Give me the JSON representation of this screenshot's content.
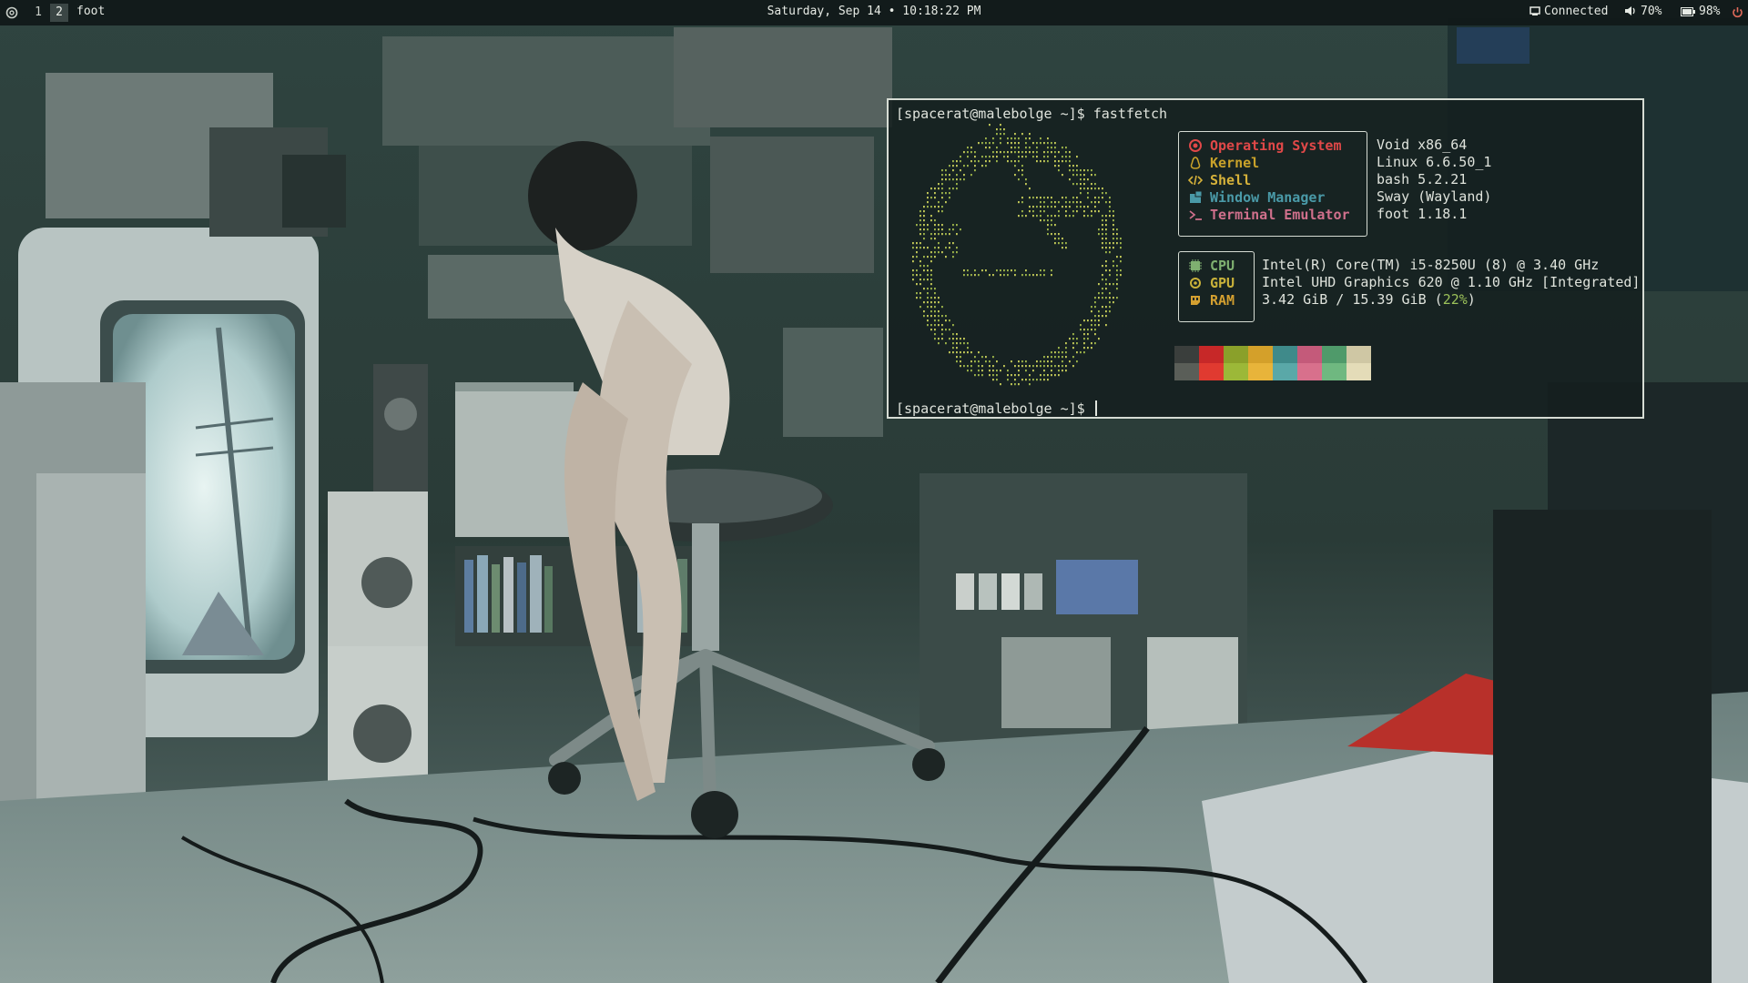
{
  "topbar": {
    "workspaces": [
      "1",
      "2"
    ],
    "active_workspace": "2",
    "app_title": "foot",
    "clock": "Saturday, Sep 14 • 10:18:22 PM",
    "network": "Connected",
    "volume": "70%",
    "battery": "98%",
    "icons": [
      "void-logo-icon",
      "network-icon",
      "volume-icon",
      "battery-icon",
      "power-icon"
    ]
  },
  "terminal": {
    "prompt1": "[spacerat@malebolge ~]$ fastfetch",
    "prompt2": "[spacerat@malebolge ~]$ ",
    "os_info": [
      {
        "key": "Operating System",
        "value": "Void x86_64",
        "color": "#e04848",
        "icon": "void-logo-icon"
      },
      {
        "key": "Kernel",
        "value": "Linux 6.6.50_1",
        "color": "#c9a22a",
        "icon": "penguin-icon"
      },
      {
        "key": "Shell",
        "value": "bash 5.2.21",
        "color": "#d6b23a",
        "icon": "code-icon"
      },
      {
        "key": "Window Manager",
        "value": "Sway (Wayland)",
        "color": "#4a9aa8",
        "icon": "window-icon"
      },
      {
        "key": "Terminal Emulator",
        "value": "foot 1.18.1",
        "color": "#d0708c",
        "icon": "terminal-icon"
      }
    ],
    "hw_info": [
      {
        "key": "CPU",
        "value": "Intel(R) Core(TM) i5-8250U (8) @ 3.40 GHz",
        "color": "#7fb070",
        "icon": "chip-icon"
      },
      {
        "key": "GPU",
        "value": "Intel UHD Graphics 620 @ 1.10 GHz [Integrated]",
        "color": "#c9b23a",
        "icon": "gpu-icon"
      },
      {
        "key": "RAM",
        "value_prefix": "3.42 GiB / 15.39 GiB (",
        "value_pct": "22%",
        "value_suffix": ")",
        "color": "#d4a030",
        "icon": "memory-icon"
      }
    ],
    "palette_top": [
      "#3a3e3c",
      "#c72828",
      "#8aa02a",
      "#d4a02a",
      "#3f8a8a",
      "#c45a7a",
      "#4f9a6a",
      "#cfc7a4"
    ],
    "palette_bottom": [
      "#5a5e58",
      "#e03a30",
      "#9cb838",
      "#e8b43a",
      "#5aa8a8",
      "#d8708c",
      "#6fb880",
      "#e4dcb8"
    ]
  }
}
